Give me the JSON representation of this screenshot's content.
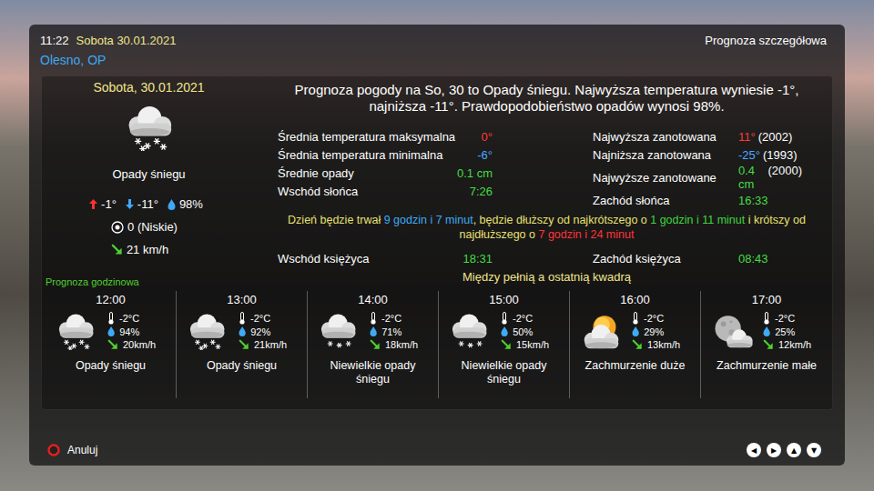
{
  "header": {
    "time": "11:22",
    "date": "Sobota 30.01.2021",
    "title": "Prognoza szczegółowa",
    "location": "Olesno, OP"
  },
  "today": {
    "date": "Sobota, 30.01.2021",
    "kind": "snow",
    "condition": "Opady śniegu",
    "max": "-1°",
    "min": "-11°",
    "precip": "98%",
    "uv": "0 (Niskie)",
    "wind": "21 km/h"
  },
  "summary": "Prognoza pogody na So, 30 to Opady śniegu. Najwyższa temperatura wyniesie -1°, najniższa -11°. Prawdopodobieństwo opadów wynosi 98%.",
  "stats": {
    "left": [
      {
        "label": "Średnia temperatura maksymalna",
        "value": "0°",
        "note": "",
        "color": "#ff3b3b"
      },
      {
        "label": "Średnia temperatura minimalna",
        "value": "-6°",
        "note": "",
        "color": "#4aa8ff"
      },
      {
        "label": "Średnie opady",
        "value": "0.1 cm",
        "note": "",
        "color": "#44dd44"
      },
      {
        "label": "Wschód słońca",
        "value": "7:26",
        "note": "",
        "color": "#44dd44"
      }
    ],
    "right": [
      {
        "label": "Najwyższa zanotowana",
        "value": "11°",
        "note": "(2002)",
        "color": "#ff3b3b"
      },
      {
        "label": "Najniższa zanotowana",
        "value": "-25°",
        "note": "(1993)",
        "color": "#4aa8ff"
      },
      {
        "label": "Najwyższe zanotowane",
        "value": "0.4 cm",
        "note": "(2000)",
        "color": "#44dd44"
      },
      {
        "label": "Zachód słońca",
        "value": "16:33",
        "note": "",
        "color": "#44dd44"
      }
    ]
  },
  "daylight": [
    {
      "text": "Dzień będzie trwał ",
      "color": "#e8e070"
    },
    {
      "text": "9 godzin i 7 minut",
      "color": "#3fa9f5"
    },
    {
      "text": ", będzie dłuższy od najkrótszego o ",
      "color": "#e8e070"
    },
    {
      "text": "1 godzin i 11 minut",
      "color": "#3fd43f"
    },
    {
      "text": " i krótszy od najdłuższego o ",
      "color": "#e8e070"
    },
    {
      "text": "7 godzin i 24 minut",
      "color": "#ff3535"
    }
  ],
  "moon": [
    {
      "label": "Wschód księżyca",
      "value": "18:31",
      "color": "#44dd44"
    },
    {
      "label": "Zachód księżyca",
      "value": "08:43",
      "color": "#44dd44"
    }
  ],
  "moon_phase": "Między pełnią a ostatnią kwadrą",
  "hourly": {
    "label": "Prognoza godzinowa",
    "items": [
      {
        "time": "12:00",
        "kind": "snow",
        "temp": "-2°C",
        "humidity": "94%",
        "wind": "20km/h",
        "condition": "Opady śniegu"
      },
      {
        "time": "13:00",
        "kind": "snow",
        "temp": "-2°C",
        "humidity": "92%",
        "wind": "21km/h",
        "condition": "Opady śniegu"
      },
      {
        "time": "14:00",
        "kind": "light-snow",
        "temp": "-2°C",
        "humidity": "71%",
        "wind": "18km/h",
        "condition": "Niewielkie opady śniegu"
      },
      {
        "time": "15:00",
        "kind": "light-snow",
        "temp": "-2°C",
        "humidity": "50%",
        "wind": "15km/h",
        "condition": "Niewielkie opady śniegu"
      },
      {
        "time": "16:00",
        "kind": "sun-cloud",
        "temp": "-2°C",
        "humidity": "29%",
        "wind": "13km/h",
        "condition": "Zachmurzenie duże"
      },
      {
        "time": "17:00",
        "kind": "moon-cloud",
        "temp": "-2°C",
        "humidity": "25%",
        "wind": "12km/h",
        "condition": "Zachmurzenie małe"
      }
    ]
  },
  "footer": {
    "cancel": "Anuluj",
    "nav": [
      "◀",
      "▶",
      "▲",
      "▼"
    ]
  }
}
